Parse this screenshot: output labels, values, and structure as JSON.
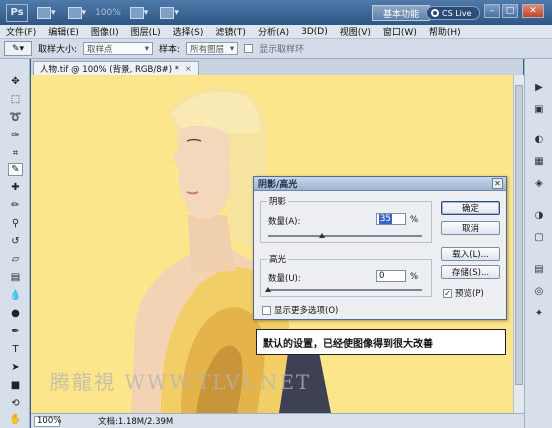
{
  "appbar": {
    "logo": "Ps",
    "zoom": "100%",
    "workspace": "基本功能",
    "arrows": "»",
    "cslive": "CS Live",
    "min": "–",
    "max": "□",
    "close": "✕"
  },
  "menu": [
    "文件(F)",
    "编辑(E)",
    "图像(I)",
    "图层(L)",
    "选择(S)",
    "滤镜(T)",
    "分析(A)",
    "3D(D)",
    "视图(V)",
    "窗口(W)",
    "帮助(H)"
  ],
  "options": {
    "sample_size_label": "取样大小:",
    "sample_size_value": "取样点",
    "sample_label": "样本:",
    "sample_value": "所有图层",
    "show_ring_label": "显示取样环"
  },
  "document": {
    "tab_title": "人物.tif @ 100% (背景, RGB/8#) *",
    "tab_close": "×",
    "zoom": "100%",
    "doc_info": "文档:1.18M/2.39M"
  },
  "dialog": {
    "title": "阴影/高光",
    "close": "✕",
    "shadows_legend": "阴影",
    "shadows_amount_label": "数量(A):",
    "shadows_amount_value": "35",
    "shadows_percent": 35,
    "highlights_legend": "高光",
    "highlights_amount_label": "数量(U):",
    "highlights_amount_value": "0",
    "highlights_percent": 0,
    "percent_sign": "%",
    "more_options_label": "显示更多选项(O)",
    "ok": "确定",
    "cancel": "取消",
    "load": "载入(L)...",
    "save": "存储(S)...",
    "preview": "预览(P)",
    "preview_checked": true
  },
  "caption": "默认的设置，已经使图像得到很大改善",
  "watermark": "腾龍視 WWW.TLVI.NET"
}
